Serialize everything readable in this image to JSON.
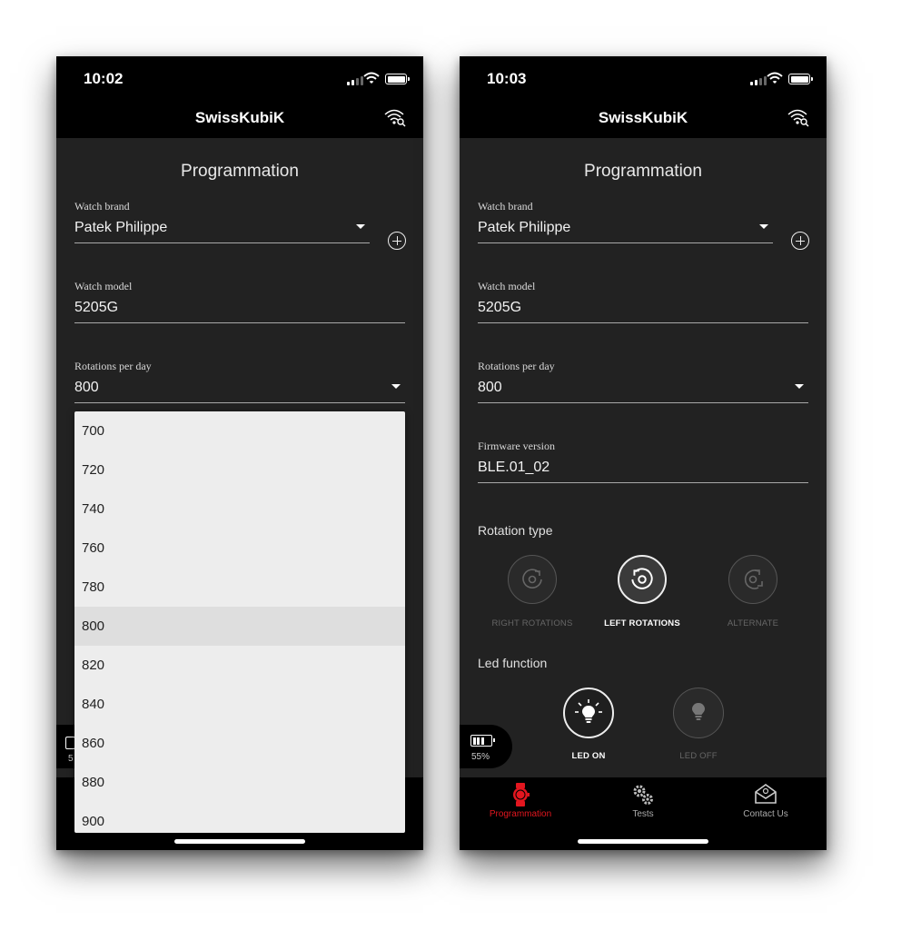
{
  "phone1": {
    "status": {
      "time": "10:02"
    },
    "header": {
      "title": "SwissKubiK",
      "scan_icon": "bluetooth-scan-icon"
    },
    "section_title": "Programmation",
    "watch_brand": {
      "label": "Watch brand",
      "value": "Patek Philippe"
    },
    "watch_model": {
      "label": "Watch model",
      "value": "5205G"
    },
    "rotations": {
      "label": "Rotations per day",
      "value": "800",
      "options": [
        "700",
        "720",
        "740",
        "760",
        "780",
        "800",
        "820",
        "840",
        "860",
        "880",
        "900"
      ]
    },
    "battery": {
      "level": "5"
    }
  },
  "phone2": {
    "status": {
      "time": "10:03"
    },
    "header": {
      "title": "SwissKubiK",
      "scan_icon": "bluetooth-scan-icon"
    },
    "section_title": "Programmation",
    "watch_brand": {
      "label": "Watch brand",
      "value": "Patek Philippe"
    },
    "watch_model": {
      "label": "Watch model",
      "value": "5205G"
    },
    "rotations": {
      "label": "Rotations per day",
      "value": "800"
    },
    "firmware": {
      "label": "Firmware version",
      "value": "BLE.01_02"
    },
    "rotation_type": {
      "heading": "Rotation type",
      "options": [
        {
          "label": "RIGHT ROTATIONS",
          "selected": false,
          "icon": "rotate-right-icon"
        },
        {
          "label": "LEFT ROTATIONS",
          "selected": true,
          "icon": "rotate-left-icon"
        },
        {
          "label": "ALTERNATE",
          "selected": false,
          "icon": "rotate-alternate-icon"
        }
      ]
    },
    "led_function": {
      "heading": "Led function",
      "options": [
        {
          "label": "LED ON",
          "selected": true,
          "icon": "bulb-on-icon"
        },
        {
          "label": "LED OFF",
          "selected": false,
          "icon": "bulb-off-icon"
        }
      ]
    },
    "battery": {
      "level": "55%"
    },
    "nav": [
      {
        "label": "Programmation",
        "icon": "watch-icon",
        "active": true
      },
      {
        "label": "Tests",
        "icon": "gears-icon",
        "active": false
      },
      {
        "label": "Contact Us",
        "icon": "mail-icon",
        "active": false
      }
    ]
  },
  "colors": {
    "accent": "#e3161f",
    "background": "#222222",
    "bar": "#000000",
    "dropdown": "#ededed"
  }
}
